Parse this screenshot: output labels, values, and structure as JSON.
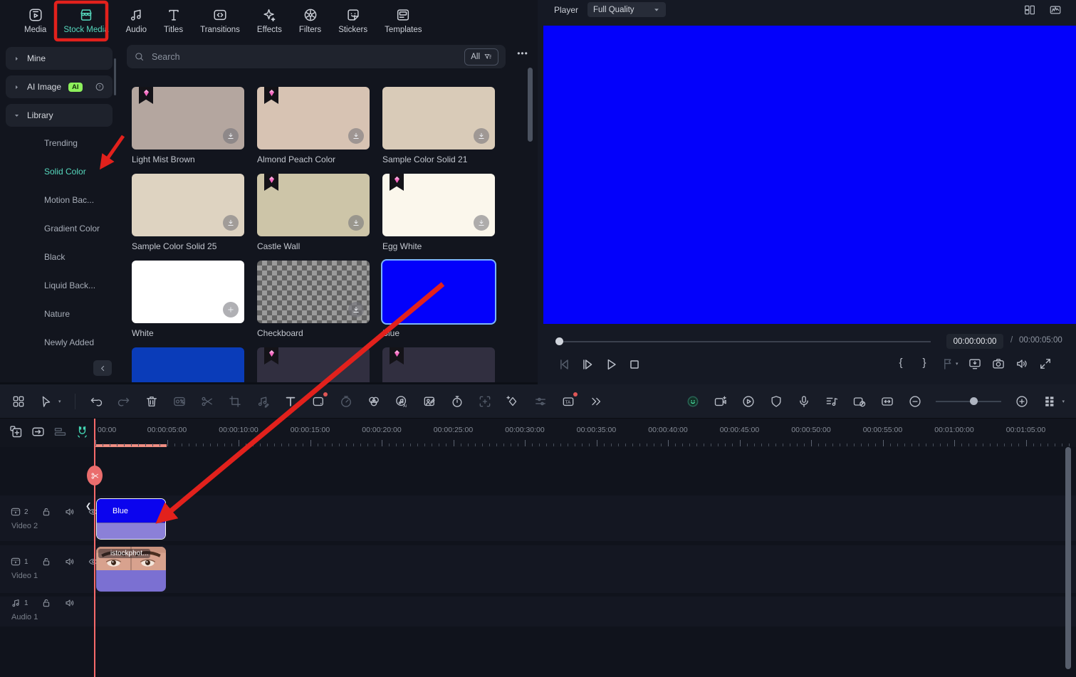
{
  "colors": {
    "accent_teal": "#56d8bd",
    "annotation_red": "#e2211c",
    "preview_blue": "#0301fb",
    "clip_purple": "#8b80d8",
    "clip_purple_2": "#7b70d2",
    "playhead_red": "#f66a6a",
    "ai_badge_green": "#8df05c",
    "selected_tile_border": "#7cb6ff"
  },
  "top_tabs": [
    {
      "id": "media",
      "label": "Media",
      "icon": "media-icon",
      "active": false
    },
    {
      "id": "stock-media",
      "label": "Stock Media",
      "icon": "stock-media-icon",
      "active": true,
      "annotated": true
    },
    {
      "id": "audio",
      "label": "Audio",
      "icon": "audio-icon",
      "active": false
    },
    {
      "id": "titles",
      "label": "Titles",
      "icon": "titles-icon",
      "active": false
    },
    {
      "id": "transitions",
      "label": "Transitions",
      "icon": "transitions-icon",
      "active": false
    },
    {
      "id": "effects",
      "label": "Effects",
      "icon": "effects-icon",
      "active": false
    },
    {
      "id": "filters",
      "label": "Filters",
      "icon": "filters-icon",
      "active": false
    },
    {
      "id": "stickers",
      "label": "Stickers",
      "icon": "stickers-icon",
      "active": false
    },
    {
      "id": "templates",
      "label": "Templates",
      "icon": "templates-icon",
      "active": false
    }
  ],
  "sidebar": {
    "mine_label": "Mine",
    "ai_image_label": "AI Image",
    "ai_badge": "AI",
    "library_label": "Library",
    "items": [
      "Trending",
      "Solid Color",
      "Motion Bac...",
      "Gradient Color",
      "Black",
      "Liquid Back...",
      "Nature",
      "Newly Added"
    ],
    "selected": "Solid Color"
  },
  "search": {
    "placeholder": "Search",
    "filter_label": "All",
    "more_label": "•••"
  },
  "media_grid": {
    "tiles": [
      {
        "name": "Light Mist Brown",
        "color": "#b4a69f",
        "premium": true,
        "corner": "download"
      },
      {
        "name": "Almond Peach Color",
        "color": "#d7c3b3",
        "premium": true,
        "corner": "download"
      },
      {
        "name": "Sample Color Solid 21",
        "color": "#d9cbb8",
        "premium": false,
        "corner": "download"
      },
      {
        "name": "Sample Color Solid 25",
        "color": "#ded3c1",
        "premium": false,
        "corner": "download"
      },
      {
        "name": "Castle Wall",
        "color": "#cdc5a8",
        "premium": true,
        "corner": "download"
      },
      {
        "name": "Egg White",
        "color": "#fbf7ec",
        "premium": true,
        "corner": "download"
      },
      {
        "name": "White",
        "color": "#ffffff",
        "premium": false,
        "corner": "plus"
      },
      {
        "name": "Checkboard",
        "pattern": "checker",
        "premium": false,
        "corner": "download"
      },
      {
        "name": "Blue",
        "color": "#0301fb",
        "premium": false,
        "selected": true
      },
      {
        "name": "",
        "color": "#0a3cb9",
        "premium": false
      },
      {
        "name": "",
        "color": "#312f40",
        "premium": true
      },
      {
        "name": "",
        "color": "#312f40",
        "premium": true
      }
    ]
  },
  "player": {
    "title": "Player",
    "quality": "Full Quality",
    "current_time": "00:00:00:00",
    "separator": "/",
    "duration": "00:00:05:00",
    "header_tools": [
      {
        "icon": "layout-icon"
      },
      {
        "icon": "scopes-icon"
      }
    ],
    "transport": [
      {
        "icon": "prev-frame-icon",
        "dim": true
      },
      {
        "icon": "play-from-start-icon"
      },
      {
        "icon": "play-icon"
      },
      {
        "icon": "stop-icon"
      }
    ],
    "tools": [
      {
        "icon": "mark-in-icon",
        "glyph": "{"
      },
      {
        "icon": "mark-out-icon",
        "glyph": "}"
      },
      {
        "icon": "flag-icon",
        "dim": true,
        "caret": true
      },
      {
        "icon": "display-icon"
      },
      {
        "icon": "snapshot-icon"
      },
      {
        "icon": "volume-icon"
      },
      {
        "icon": "fullscreen-icon"
      }
    ]
  },
  "timeline": {
    "edit_tools": [
      {
        "icon": "apps-grid-icon"
      },
      {
        "icon": "select-tool-icon",
        "caret": true
      },
      {
        "divider": true
      },
      {
        "icon": "undo-icon"
      },
      {
        "icon": "redo-icon",
        "dim": true
      },
      {
        "icon": "delete-icon"
      },
      {
        "icon": "screen-record-icon",
        "dim": true
      },
      {
        "icon": "split-icon",
        "dim": true
      },
      {
        "icon": "crop-icon",
        "dim": true
      },
      {
        "icon": "audio-edit-icon",
        "dim": true
      },
      {
        "icon": "text-icon"
      },
      {
        "icon": "mask-icon",
        "dot": true
      },
      {
        "icon": "speed-icon",
        "dim": true
      },
      {
        "icon": "color-icon"
      },
      {
        "icon": "ai-audio-icon"
      },
      {
        "icon": "ai-portrait-icon"
      },
      {
        "icon": "timer-icon"
      },
      {
        "icon": "motion-track-icon",
        "dim": true
      },
      {
        "icon": "keyframe-icon"
      },
      {
        "icon": "adjust-icon",
        "dim": true
      },
      {
        "icon": "ai-text-icon",
        "dot": true
      },
      {
        "icon": "more-tools-icon"
      }
    ],
    "right_tools": [
      {
        "icon": "account-avatar-icon",
        "accent": true
      },
      {
        "icon": "record-camera-icon"
      },
      {
        "icon": "render-preview-icon"
      },
      {
        "icon": "shield-icon"
      },
      {
        "icon": "voiceover-mic-icon"
      },
      {
        "icon": "music-list-icon"
      },
      {
        "icon": "hide-clip-icon"
      },
      {
        "icon": "fit-timeline-icon"
      },
      {
        "icon": "zoom-out-icon"
      },
      {
        "slider": true
      },
      {
        "icon": "zoom-in-icon"
      },
      {
        "icon": "track-manager-icon",
        "caret": true
      }
    ],
    "header_tools": [
      {
        "icon": "insert-media-icon"
      },
      {
        "icon": "import-to-track-icon"
      },
      {
        "icon": "ripple-delete-icon",
        "dim": true
      },
      {
        "icon": "snap-icon",
        "accent": true
      }
    ],
    "ruler_labels": [
      "00:00",
      "00:00:05:00",
      "00:00:10:00",
      "00:00:15:00",
      "00:00:20:00",
      "00:00:25:00",
      "00:00:30:00",
      "00:00:35:00",
      "00:00:40:00",
      "00:00:45:00",
      "00:00:50:00",
      "00:00:55:00",
      "00:01:00:00",
      "00:01:05:00"
    ],
    "tracks": [
      {
        "kind": "video",
        "number": "2",
        "label": "Video 2",
        "clip_name": "Blue"
      },
      {
        "kind": "video",
        "number": "1",
        "label": "Video 1",
        "clip_name": "istockphot..."
      },
      {
        "kind": "audio",
        "number": "1",
        "label": "Audio 1"
      }
    ]
  }
}
